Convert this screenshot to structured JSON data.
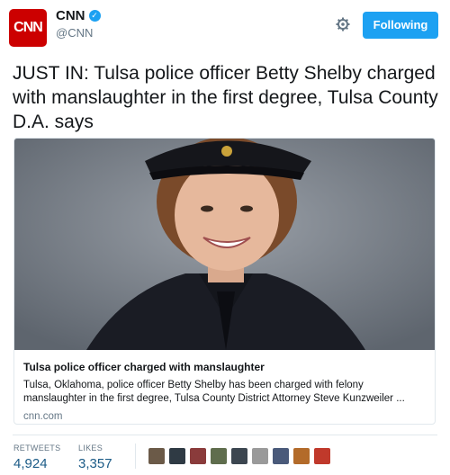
{
  "account": {
    "logo_text": "CNN",
    "display_name": "CNN",
    "handle": "@CNN",
    "verified": true
  },
  "actions": {
    "follow_label": "Following"
  },
  "tweet": {
    "text": "JUST IN: Tulsa police officer Betty Shelby charged with manslaughter in the first degree, Tulsa County D.A. says"
  },
  "card": {
    "title": "Tulsa police officer charged with manslaughter",
    "description": "Tulsa, Oklahoma, police officer Betty Shelby has been charged with felony manslaughter in the first degree, Tulsa County District Attorney Steve Kunzweiler ...",
    "domain": "cnn.com"
  },
  "stats": {
    "retweets_label": "RETWEETS",
    "retweets_value": "4,924",
    "likes_label": "LIKES",
    "likes_value": "3,357"
  },
  "likers": [
    {
      "color": "#6b5a48"
    },
    {
      "color": "#2f3a44"
    },
    {
      "color": "#8a3b3b"
    },
    {
      "color": "#5f6d4d"
    },
    {
      "color": "#3c4650"
    },
    {
      "color": "#9a9a9a"
    },
    {
      "color": "#4a5a7a"
    },
    {
      "color": "#b36b2a"
    },
    {
      "color": "#c0392b"
    }
  ],
  "colors": {
    "brand_red": "#cc0000",
    "twitter_blue": "#1da1f2",
    "stat_blue": "#1b5b87"
  }
}
